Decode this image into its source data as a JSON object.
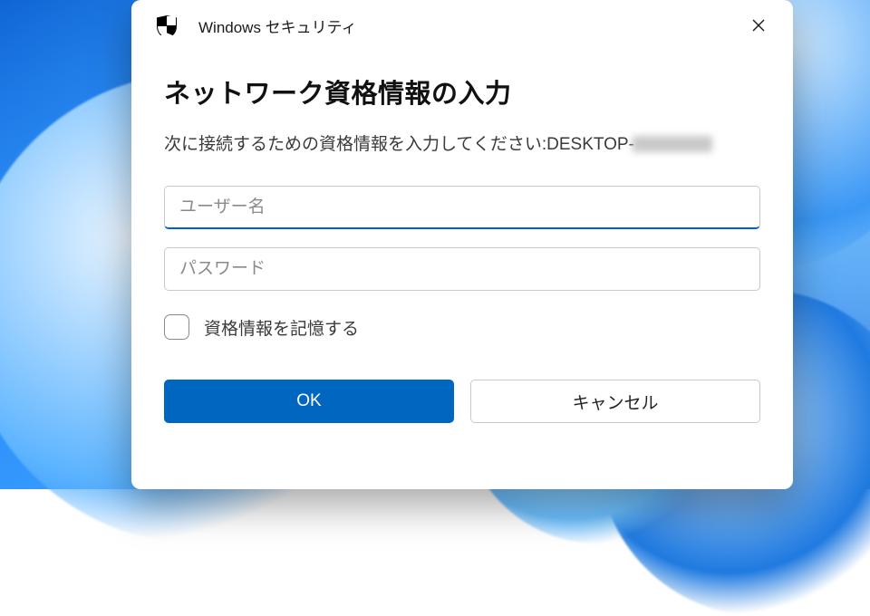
{
  "dialog": {
    "app_title": "Windows セキュリティ",
    "heading": "ネットワーク資格情報の入力",
    "prompt_prefix": "次に接続するための資格情報を入力してください: ",
    "target_host": "DESKTOP-",
    "fields": {
      "username": {
        "placeholder": "ユーザー名",
        "value": ""
      },
      "password": {
        "placeholder": "パスワード",
        "value": ""
      }
    },
    "remember_label": "資格情報を記憶する",
    "remember_checked": false,
    "buttons": {
      "ok": "OK",
      "cancel": "キャンセル"
    }
  },
  "icons": {
    "shield": "shield-icon",
    "close": "close-icon"
  },
  "colors": {
    "accent": "#0067c0"
  }
}
